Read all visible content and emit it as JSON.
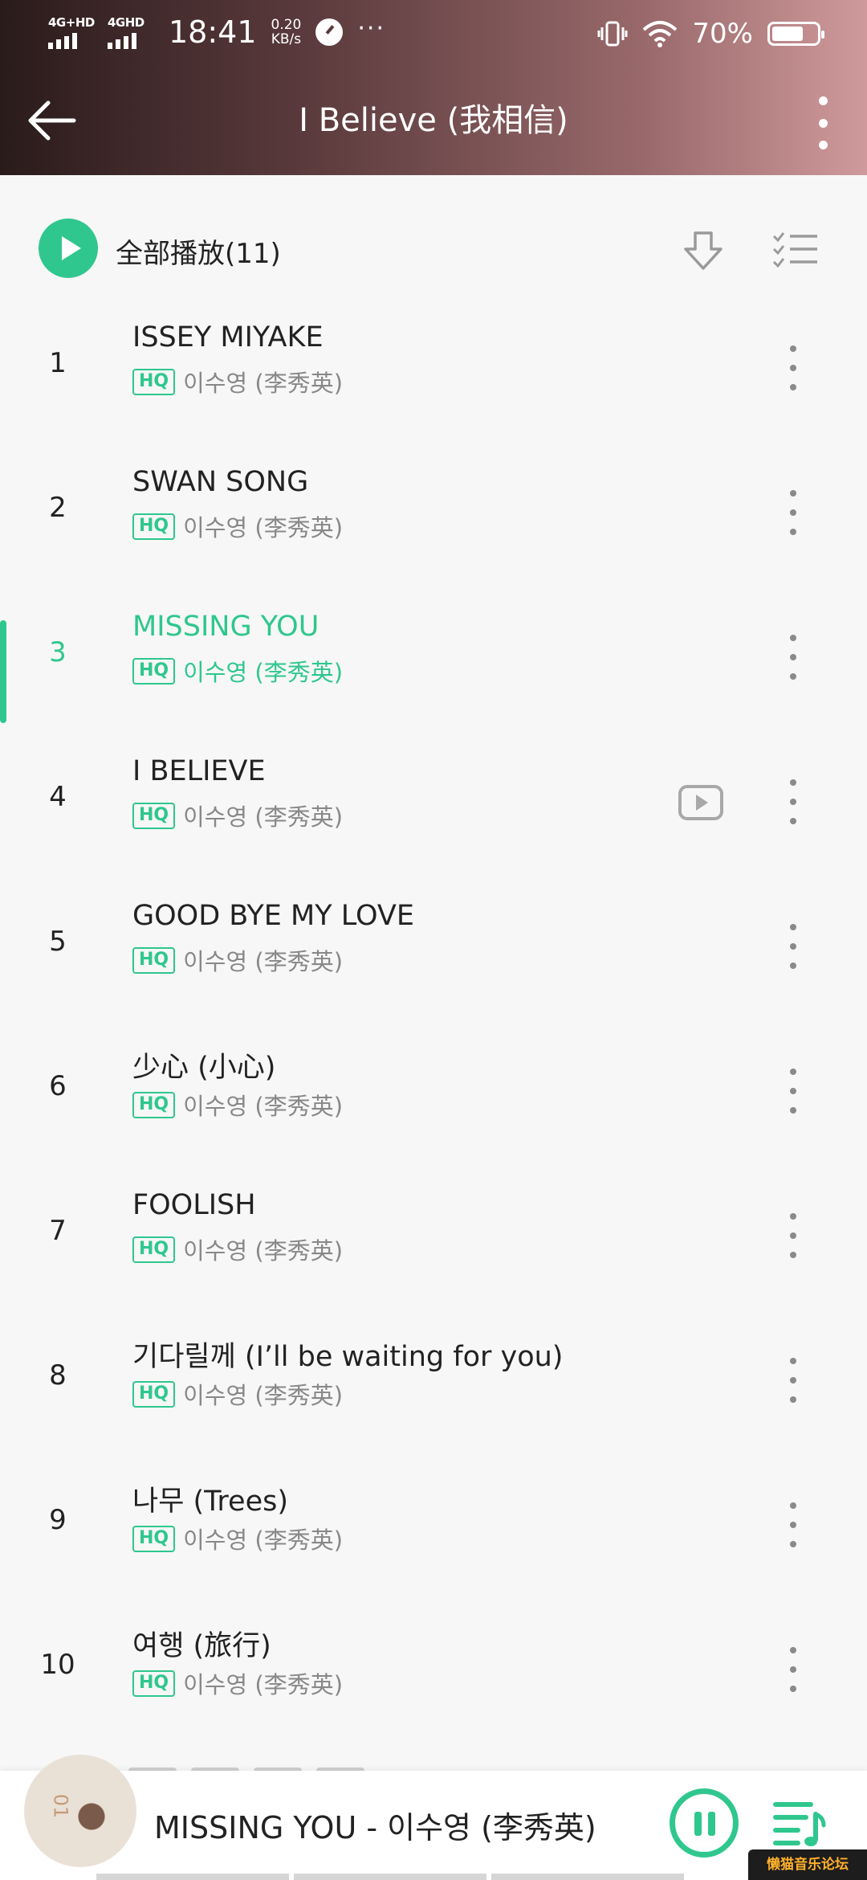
{
  "status_bar": {
    "net1": "4G+HD",
    "net2": "4GHD",
    "time": "18:41",
    "speed_value": "0.20",
    "speed_unit": "KB/s",
    "more": "···",
    "battery": "70%",
    "battery_level": 0.7
  },
  "header": {
    "title": "I Believe (我相信)",
    "back_icon": "arrow-left-icon",
    "more_icon": "more-vertical-icon"
  },
  "play_all": {
    "label": "全部播放(11)"
  },
  "songs": [
    {
      "index": "1",
      "title": "ISSEY MIYAKE",
      "quality": "HQ",
      "artist": "이수영 (李秀英)"
    },
    {
      "index": "2",
      "title": "SWAN SONG",
      "quality": "HQ",
      "artist": "이수영 (李秀英)"
    },
    {
      "index": "3",
      "title": "MISSING YOU",
      "quality": "HQ",
      "artist": "이수영 (李秀英)"
    },
    {
      "index": "4",
      "title": "I BELIEVE",
      "quality": "HQ",
      "artist": "이수영 (李秀英)"
    },
    {
      "index": "5",
      "title": "GOOD BYE MY LOVE",
      "quality": "HQ",
      "artist": "이수영 (李秀英)"
    },
    {
      "index": "6",
      "title": "少心 (小心)",
      "quality": "HQ",
      "artist": "이수영 (李秀英)"
    },
    {
      "index": "7",
      "title": "FOOLISH",
      "quality": "HQ",
      "artist": "이수영 (李秀英)"
    },
    {
      "index": "8",
      "title": "기다릴께 (I’ll be waiting for you)",
      "quality": "HQ",
      "artist": "이수영 (李秀英)"
    },
    {
      "index": "9",
      "title": "나무 (Trees)",
      "quality": "HQ",
      "artist": "이수영 (李秀英)"
    },
    {
      "index": "10",
      "title": "여행 (旅行)",
      "quality": "HQ",
      "artist": "이수영 (李秀英)"
    }
  ],
  "player": {
    "now_playing": "MISSING YOU - 이수영 (李秀英)"
  },
  "watermark": "懒猫音乐论坛",
  "colors": {
    "accent": "#2fc78e",
    "header_start": "#2a1b1b",
    "header_end": "#d09a9c"
  }
}
